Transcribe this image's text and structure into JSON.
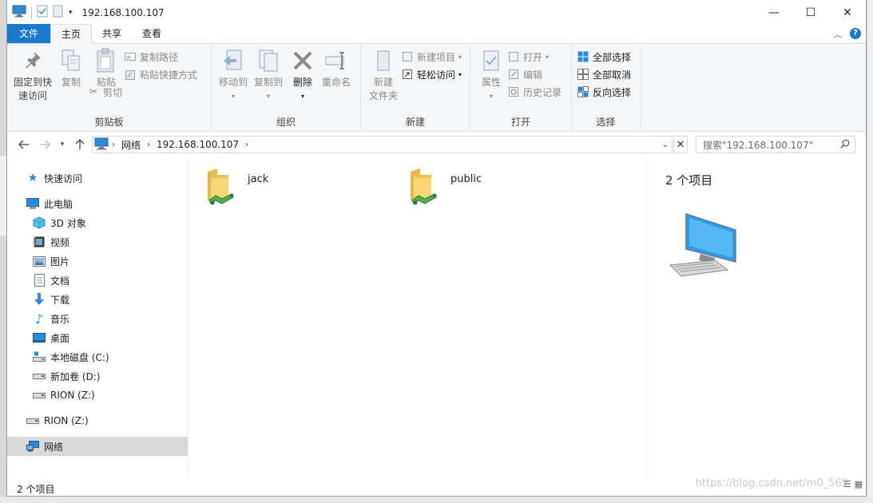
{
  "window": {
    "title": "192.168.100.107",
    "minimize": "—",
    "maximize": "☐",
    "close": "✕"
  },
  "tabs": {
    "file": "文件",
    "home": "主页",
    "share": "共享",
    "view": "查看"
  },
  "ribbon": {
    "clipboard": {
      "label": "剪贴板",
      "pin": "固定到快\n速访问",
      "pin_l1": "固定到快",
      "pin_l2": "速访问",
      "copy": "复制",
      "paste": "粘贴",
      "copy_path": "复制路径",
      "paste_shortcut": "粘贴快捷方式",
      "cut": "剪切"
    },
    "organize": {
      "label": "组织",
      "move_to": "移动到",
      "copy_to": "复制到",
      "delete": "删除",
      "rename": "重命名"
    },
    "new": {
      "label": "新建",
      "new_folder_l1": "新建",
      "new_folder_l2": "文件夹",
      "new_item": "新建项目",
      "easy_access": "轻松访问"
    },
    "open": {
      "label": "打开",
      "properties": "属性",
      "open": "打开",
      "edit": "编辑",
      "history": "历史记录"
    },
    "select": {
      "label": "选择",
      "select_all": "全部选择",
      "select_none": "全部取消",
      "invert": "反向选择"
    }
  },
  "address": {
    "crumbs": [
      "网络",
      "192.168.100.107"
    ],
    "search_placeholder": "搜索\"192.168.100.107\""
  },
  "sidebar": {
    "quick_access": "快速访问",
    "this_pc": "此电脑",
    "items": [
      {
        "label": "3D 对象",
        "icon": "3d-objects-icon"
      },
      {
        "label": "视频",
        "icon": "videos-icon"
      },
      {
        "label": "图片",
        "icon": "pictures-icon"
      },
      {
        "label": "文档",
        "icon": "documents-icon"
      },
      {
        "label": "下载",
        "icon": "downloads-icon"
      },
      {
        "label": "音乐",
        "icon": "music-icon"
      },
      {
        "label": "桌面",
        "icon": "desktop-icon"
      },
      {
        "label": "本地磁盘 (C:)",
        "icon": "local-disk-icon"
      },
      {
        "label": "新加卷 (D:)",
        "icon": "drive-icon"
      },
      {
        "label": "RION (Z:)",
        "icon": "network-drive-icon"
      }
    ],
    "rion": "RION (Z:)",
    "network": "网络"
  },
  "shares": [
    {
      "name": "jack"
    },
    {
      "name": "public"
    }
  ],
  "details": {
    "count": "2 个项目"
  },
  "status": {
    "count": "2 个项目"
  },
  "watermark": "https://blog.csdn.net/m0_569"
}
